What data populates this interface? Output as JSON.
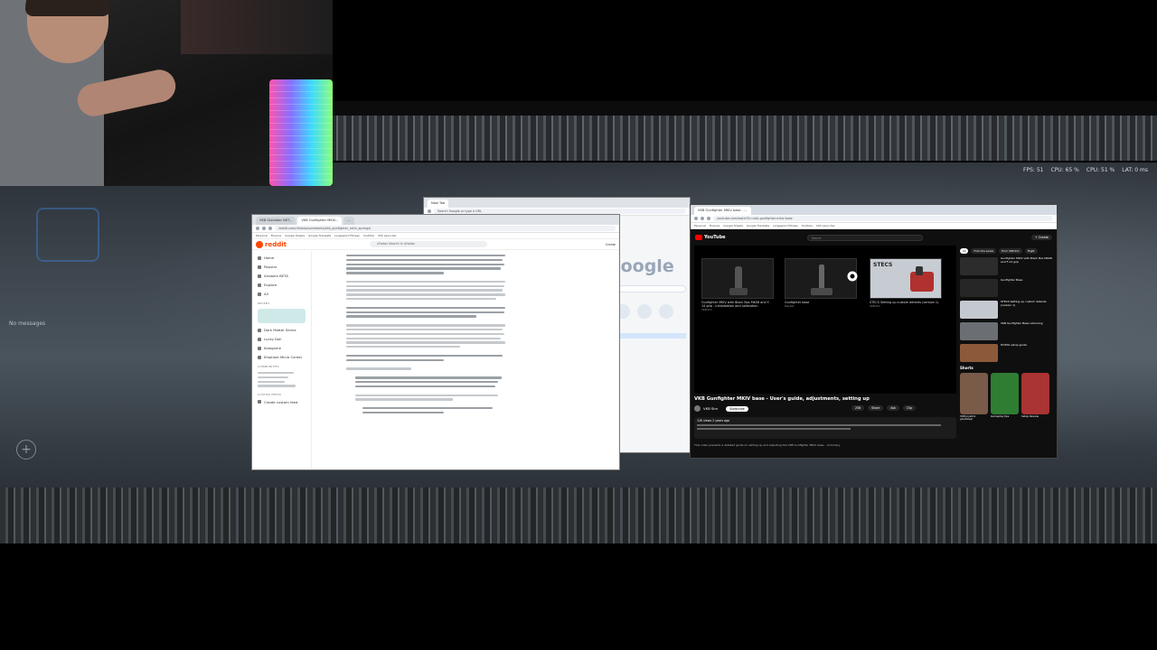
{
  "hud": {
    "fps": "FPS: 51",
    "cpu1": "CPU: 65 %",
    "cpu2": "CPU: 51 %",
    "lat": "LAT: 0 ms",
    "no_messages": "No messages",
    "plus": "+"
  },
  "reddit": {
    "tabs": [
      "VKB Gladiator NXT...",
      "VKB Gunfighter MKIV...",
      "..."
    ],
    "url": "reddit.com/r/hotas/comments/vkb_gunfighter_mkiv_springs/",
    "bookmarks": [
      "Personal",
      "Finance",
      "Google Sheets",
      "Google Translate",
      "Longsword Fitness",
      "YouTube",
      "CS5 Launcher"
    ],
    "logo": "reddit",
    "search": "r/hotas  Search in r/hotas",
    "create": "Create",
    "nav": [
      "Home",
      "Popular",
      "Answers BETA",
      "Explore",
      "All"
    ],
    "section_recent": "RECENT",
    "recent": [
      "Dark Matter Series",
      "Lucky Doll",
      "Kalegame",
      "Elephant Micro Center"
    ],
    "section_communities": "COMMUNITIES",
    "section_custom_feeds": "CUSTOM FEEDS",
    "create_custom_feed": "Create custom feed"
  },
  "google": {
    "tab": "New Tab",
    "search_placeholder": "Search Google or type a URL",
    "logo": "Google"
  },
  "youtube": {
    "tab": "VKB Gunfighter MKIV base - ...",
    "url": "youtube.com/watch?v=vkb-gunfighter-mkiv-base",
    "bookmarks": [
      "Personal",
      "Finance",
      "Google Sheets",
      "Google Translate",
      "Longsword Fitness",
      "YouTube",
      "CS5 Launcher"
    ],
    "logo": "YouTube",
    "search": "Search",
    "create": "+ Create",
    "endcards": [
      {
        "label": "Gunfighter MKIV with Black Box MK08 and F-14 grip - initialization and calibration",
        "sub": "VKB Sim"
      },
      {
        "label": "Gunfighter base",
        "sub": "Playlist"
      },
      {
        "label": "STECS Setting up custom detents (version 1)",
        "sub": "VKB Sim"
      }
    ],
    "stecs_logo": "STECS",
    "video_title": "VKB Gunfighter MKIV base - User's guide, adjustments, setting up",
    "channel": "VKB Sim",
    "subscribe": "Subscribe",
    "actions": [
      "258",
      "Share",
      "Ask",
      "Clip"
    ],
    "views": "12K views  2 years ago",
    "description_footer": "This video presents a detailed guide on setting up and adjusting the VKB Gunfighter MKIV base...   Summary",
    "chips": [
      "All",
      "From the series",
      "From VKB Sim",
      "Flight"
    ],
    "recs": [
      {
        "title": "Gunfighter MKIV with Black Box MK08 and F-14 grip"
      },
      {
        "title": "Gunfighter Base"
      },
      {
        "title": "STECS Setting up custom detents (version 1)"
      },
      {
        "title": "VKB Gunfighter Base Unboxing"
      },
      {
        "title": "HOTAS setup guide"
      }
    ],
    "shorts_heading": "Shorts",
    "shorts": [
      "VKB Joystick giveaway!",
      "Gameplay tips",
      "Setup Review",
      "Mod Tutorial"
    ]
  }
}
